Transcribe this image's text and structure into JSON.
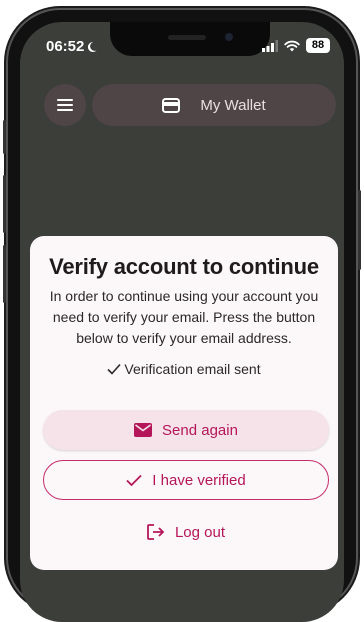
{
  "status_bar": {
    "time": "06:52",
    "battery": "88"
  },
  "header": {
    "wallet_title": "My Wallet"
  },
  "dialog": {
    "title": "Verify account to continue",
    "description": "In order to continue using your account you need to verify your email. Press the button below to verify your email address.",
    "status_text": "Verification email sent",
    "send_again_label": "Send again",
    "verified_label": "I have verified",
    "logout_label": "Log out"
  },
  "colors": {
    "accent": "#c62b6b",
    "sheet_bg": "#fcf8f9",
    "screen_bg": "#3c3e3a"
  }
}
